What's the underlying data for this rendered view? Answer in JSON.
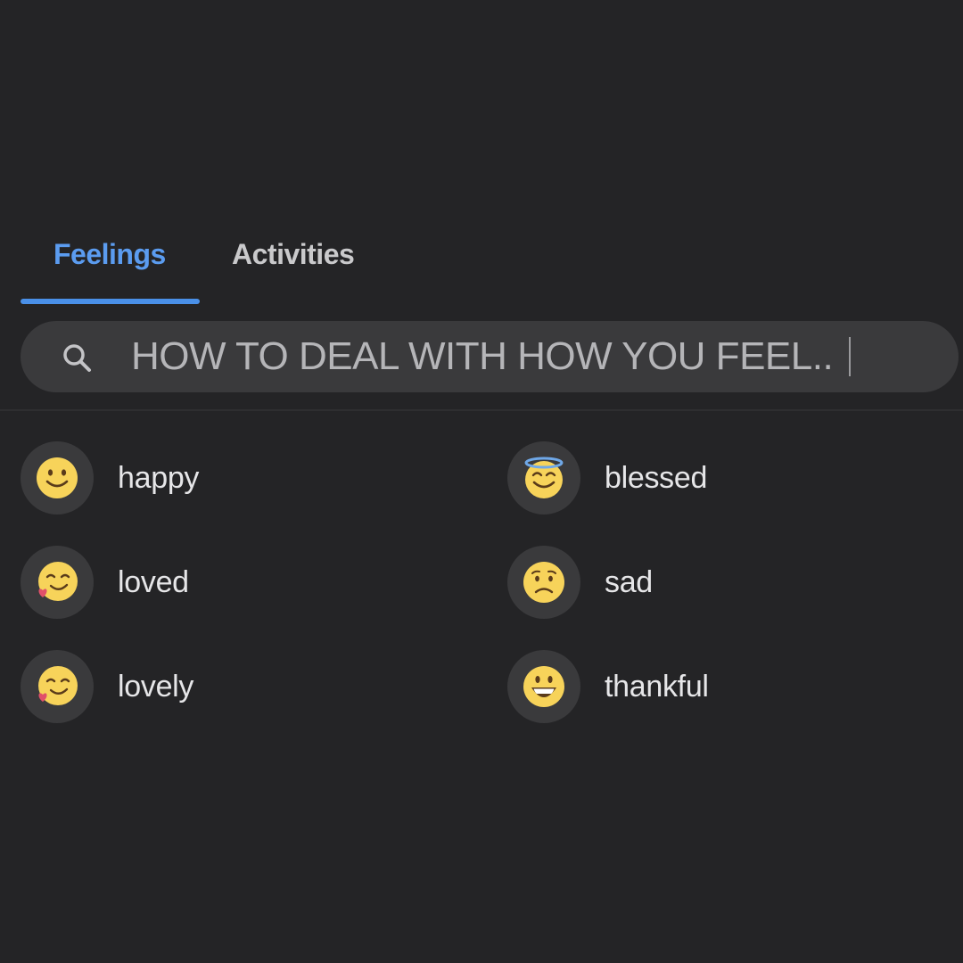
{
  "tabs": {
    "feelings": "Feelings",
    "activities": "Activities"
  },
  "search": {
    "value": "HOW TO DEAL WITH HOW YOU FEEL.."
  },
  "feelings": [
    {
      "label": "happy",
      "icon": "slightly-smiling-face-icon"
    },
    {
      "label": "blessed",
      "icon": "smiling-face-with-halo-icon"
    },
    {
      "label": "loved",
      "icon": "face-with-heart-icon"
    },
    {
      "label": "sad",
      "icon": "worried-face-icon"
    },
    {
      "label": "lovely",
      "icon": "face-with-heart-icon"
    },
    {
      "label": "thankful",
      "icon": "grinning-face-icon"
    }
  ],
  "colors": {
    "background": "#242426",
    "accent": "#4a90e8",
    "active_tab": "#5b9cf0",
    "inactive_tab": "#c9c9cb",
    "search_bg": "#3a3a3c",
    "emoji_yellow": "#f7d35a"
  }
}
